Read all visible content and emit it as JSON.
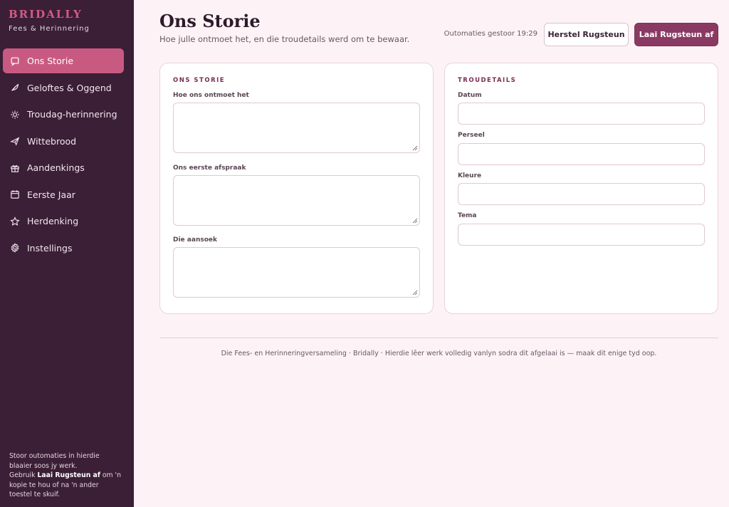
{
  "brand": {
    "title": "BRIDALLY",
    "subtitle": "Fees & Herinnering"
  },
  "sidebar": {
    "items": [
      {
        "label": "Ons Storie",
        "icon": "note-icon",
        "active": true
      },
      {
        "label": "Geloftes & Oggend",
        "icon": "feather-icon"
      },
      {
        "label": "Troudag-herinnering",
        "icon": "sun-icon"
      },
      {
        "label": "Wittebrood",
        "icon": "plane-icon"
      },
      {
        "label": "Aandenkings",
        "icon": "gift-icon"
      },
      {
        "label": "Eerste Jaar",
        "icon": "calendar-icon"
      },
      {
        "label": "Herdenking",
        "icon": "star-icon"
      },
      {
        "label": "Instellings",
        "icon": "gear-icon"
      }
    ],
    "footer": {
      "line1": "Stoor outomaties in hierdie blaaier soos jy werk.",
      "pre": "Gebruik ",
      "bold": "Laai Rugsteun af",
      "post": " om 'n kopie te hou of na 'n ander toestel te skuif."
    }
  },
  "header": {
    "title": "Ons Storie",
    "subtitle": "Hoe julle ontmoet het, en die troudetails werd om te bewaar.",
    "saved_status": "Outomaties gestoor 19:29",
    "restore_label": "Herstel Rugsteun",
    "download_label": "Laai Rugsteun af"
  },
  "story_card": {
    "heading": "ONS STORIE",
    "fields": [
      {
        "label": "Hoe ons ontmoet het",
        "value": ""
      },
      {
        "label": "Ons eerste afspraak",
        "value": ""
      },
      {
        "label": "Die aansoek",
        "value": ""
      }
    ]
  },
  "wedding_card": {
    "heading": "TROUDETAILS",
    "fields": [
      {
        "label": "Datum",
        "value": ""
      },
      {
        "label": "Perseel",
        "value": ""
      },
      {
        "label": "Kleure",
        "value": ""
      },
      {
        "label": "Tema",
        "value": ""
      }
    ]
  },
  "footer_note": "Die Fees- en Herinneringversameling · Bridally · Hierdie lêer werk volledig vanlyn sodra dit afgelaai is — maak dit enige tyd oop.",
  "colors": {
    "accent": "#c85a82",
    "sidebar": "#3a1f36",
    "primary_button": "#8a3a62",
    "background": "#fdf3f6"
  }
}
